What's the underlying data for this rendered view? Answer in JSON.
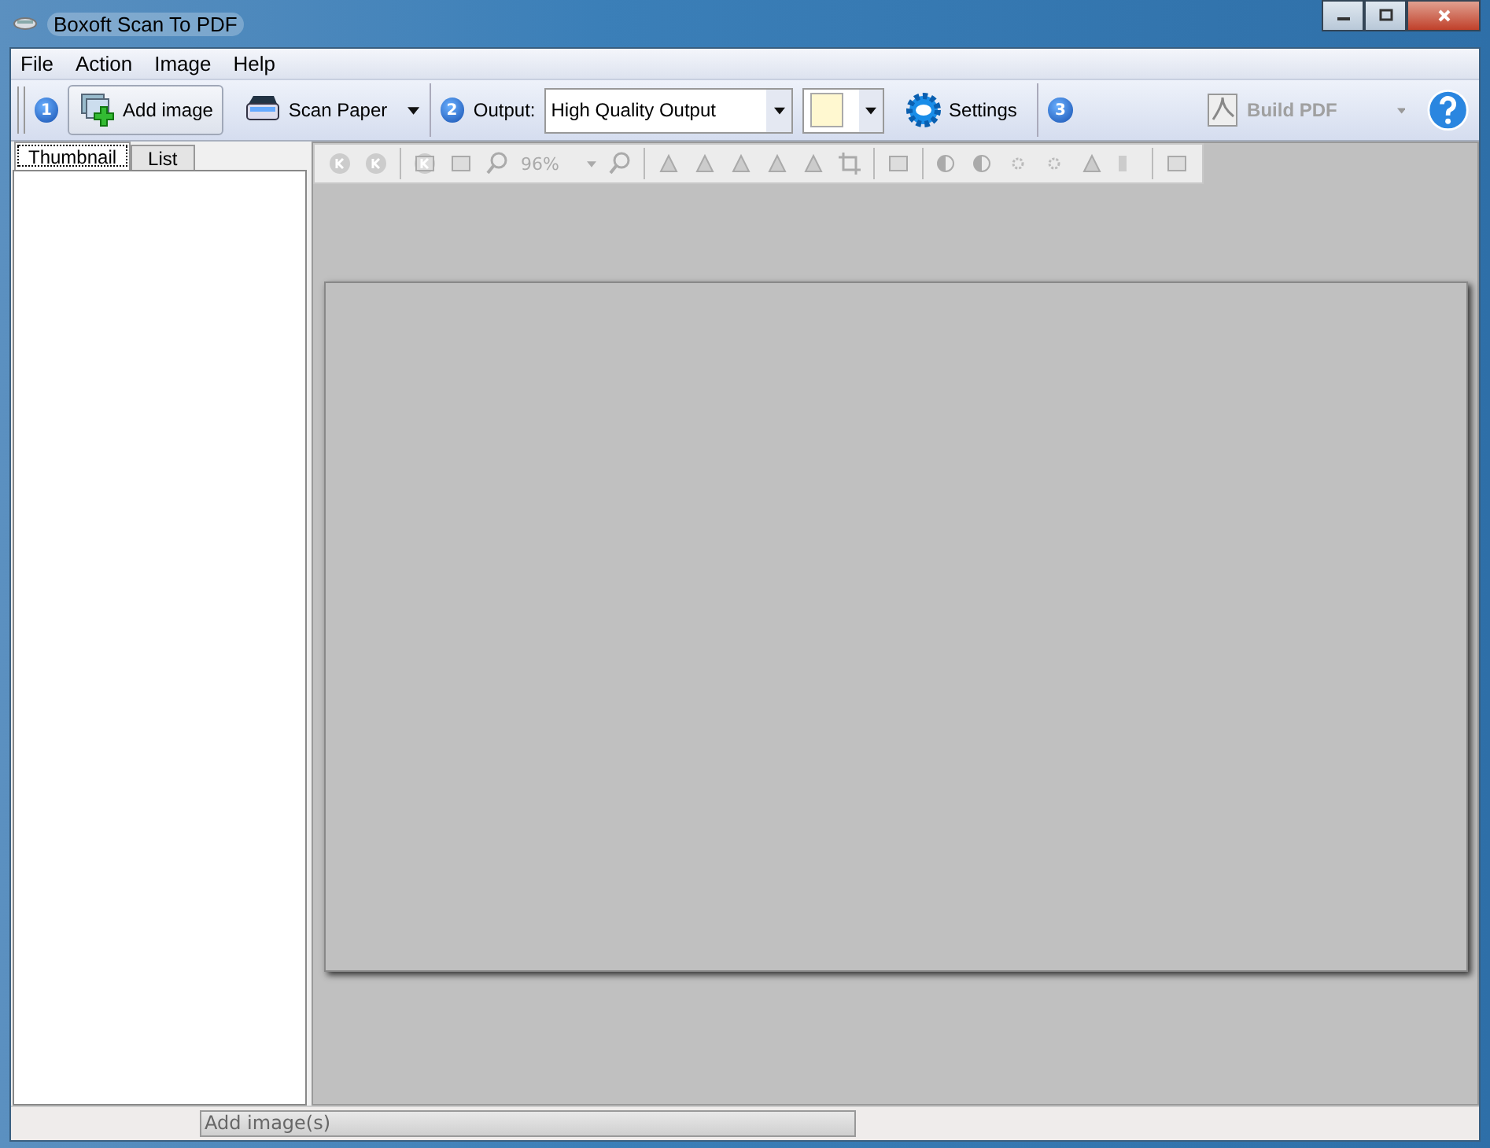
{
  "window": {
    "title": "Boxoft Scan To PDF"
  },
  "menu": [
    "File",
    "Action",
    "Image",
    "Help"
  ],
  "toolbar": {
    "step_1": "1",
    "add_image": "Add image",
    "scan_paper": "Scan Paper",
    "step_2": "2",
    "output_label": "Output:",
    "output_value": "High Quality Output",
    "settings": "Settings",
    "step_3": "3",
    "build_pdf": {
      "label": "Build PDF",
      "disabled": true
    }
  },
  "tabs": [
    {
      "label": "Thumbnail",
      "selected": true
    },
    {
      "label": "List",
      "selected": false
    }
  ],
  "viewer_toolbar": {
    "zoom": "96%",
    "disabled": true
  },
  "status_bar": {
    "progress_text": "Add image(s)",
    "level": 1
  }
}
